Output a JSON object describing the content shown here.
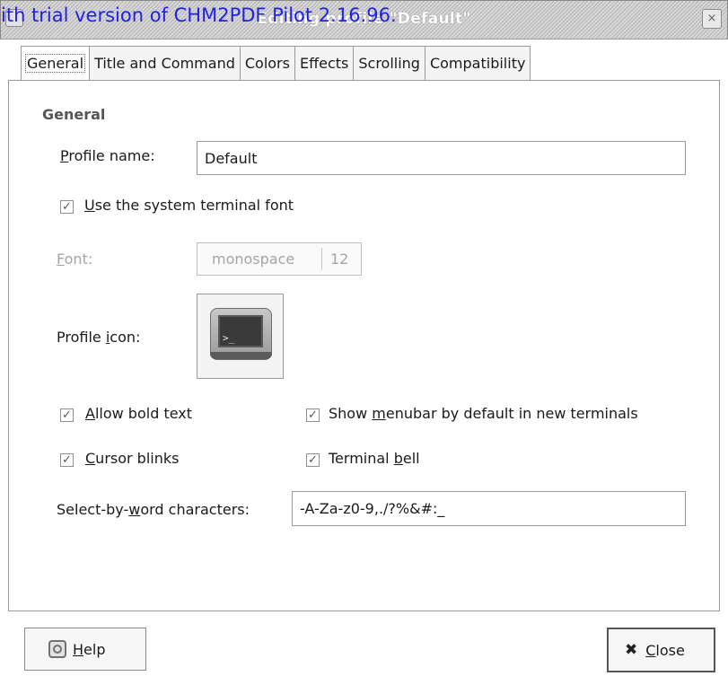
{
  "window": {
    "title": "Editing profile \"Default\"",
    "watermark": "ith trial version of CHM2PDF Pilot 2.16.96."
  },
  "tabs": [
    "General",
    "Title and Command",
    "Colors",
    "Effects",
    "Scrolling",
    "Compatibility"
  ],
  "active_tab": "General",
  "general": {
    "section_title": "General",
    "profile_name_label_u": "P",
    "profile_name_label_rest": "rofile name:",
    "profile_name_value": "Default",
    "use_system_font": {
      "checked": true,
      "label_u": "U",
      "label_rest": "se the system terminal font"
    },
    "font_label_u": "F",
    "font_label_rest": "ont:",
    "font_name": "monospace",
    "font_size": "12",
    "profile_icon_label_a": "Profile ",
    "profile_icon_label_u": "i",
    "profile_icon_label_b": "con:",
    "profile_icon_glyph": ">_",
    "checkboxes": {
      "allow_bold": {
        "checked": true,
        "label_u": "A",
        "label_rest": "llow bold text"
      },
      "show_menubar": {
        "checked": true,
        "label_a": "Show ",
        "label_u": "m",
        "label_rest": "enubar by default in new terminals"
      },
      "cursor_blinks": {
        "checked": true,
        "label_u": "C",
        "label_rest": "ursor blinks"
      },
      "terminal_bell": {
        "checked": true,
        "label_a": "Terminal ",
        "label_u": "b",
        "label_rest": "ell"
      }
    },
    "select_word_label_a": "Select-by-",
    "select_word_label_u": "w",
    "select_word_label_b": "ord characters:",
    "select_word_value": "-A-Za-z0-9,./?%&#:_"
  },
  "buttons": {
    "help_u": "H",
    "help_rest": "elp",
    "close_u": "C",
    "close_rest": "lose"
  },
  "check_glyph": "✓",
  "close_icon": "✖",
  "title_close_glyph": "×",
  "icons": [
    "window-menu-icon",
    "window-close-icon",
    "terminal-icon",
    "help-icon",
    "close-icon"
  ]
}
